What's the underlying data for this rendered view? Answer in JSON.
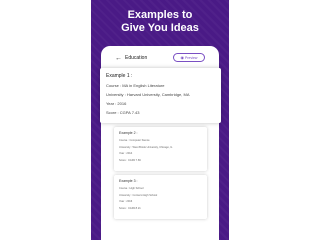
{
  "headline": {
    "line1": "Examples to",
    "line2": "Give You Ideas"
  },
  "appbar": {
    "title": "Education",
    "preview_label": "Preview"
  },
  "examples": [
    {
      "title": "Example 1 :",
      "course": "Course : MA in English Literature",
      "university": "University : Harvard University, Cambridge, MA",
      "year": "Year : 2016",
      "score": "Score : CGPA 7.43"
    },
    {
      "title": "Example 2 :",
      "course": "Course : Computer Sience",
      "university": "University : West Brook University, Chicago, IL",
      "year": "Year : 2014",
      "score": "Score : CGPA 7.69"
    },
    {
      "title": "Example 3 :",
      "course": "Course : High School",
      "university": "University : Cornerst High School",
      "year": "Year : 2016",
      "score": "Score : CGPA 8.21"
    }
  ],
  "colors": {
    "banner": "#4a1a86",
    "accent": "#7a4fc3"
  },
  "icons": {
    "back": "arrow-left-icon",
    "preview": "eye-icon"
  }
}
